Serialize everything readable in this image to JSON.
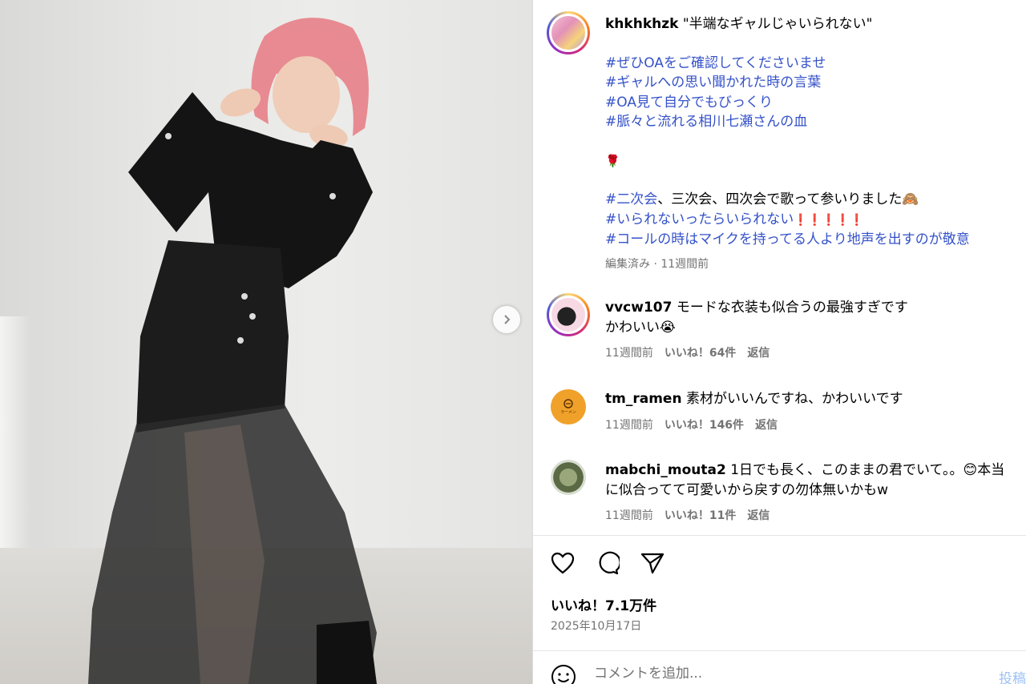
{
  "post": {
    "username": "khkhkhzk",
    "title": "\"半端なギャルじゃいられない\"",
    "hashtags_1": [
      "#ぜひOAをご確認してくださいませ",
      "#ギャルへの思い聞かれた時の言葉",
      "#OA見て自分でもびっくり",
      "#脈々と流れる相川七瀬さんの血"
    ],
    "rose": "🌹",
    "line_a_tag": "#二次会",
    "line_a_text": "、三次会、四次会で歌って参いりました🙈",
    "line_b_tag": "#いられないったらいられない",
    "line_b_marks": "❗❗❗❗❗",
    "line_c_tag": "#コールの時はマイクを持ってる人より地声を出すのが敬意",
    "meta": "編集済み · 11週間前"
  },
  "comments": [
    {
      "user": "vvcw107",
      "text": "モードな衣装も似合うの最強すぎです",
      "text2": "かわいい😭",
      "time": "11週間前",
      "likes": "いいね！64件",
      "reply": "返信"
    },
    {
      "user": "tm_ramen",
      "text": "素材がいいんですね、かわいいです",
      "avatar_label": "ラーメン",
      "time": "11週間前",
      "likes": "いいね！146件",
      "reply": "返信"
    },
    {
      "user": "mabchi_mouta2",
      "text": "1日でも長く、このままの君でいて。。😊本当",
      "text2": "に似合ってて可愛いから戻すの勿体無いかもw",
      "time": "11週間前",
      "likes": "いいね！11件",
      "reply": "返信"
    }
  ],
  "footer": {
    "likes": "いいね！7.1万件",
    "date": "2025年10月17日",
    "placeholder": "コメントを追加...",
    "post_label": "投稿"
  },
  "colors": {
    "hashtag": "#3552c9",
    "muted": "#737373",
    "post_disabled": "#9ec2f5"
  },
  "icons": [
    "chevron-right-icon",
    "heart-icon",
    "comment-icon",
    "share-icon",
    "emoji-icon"
  ]
}
